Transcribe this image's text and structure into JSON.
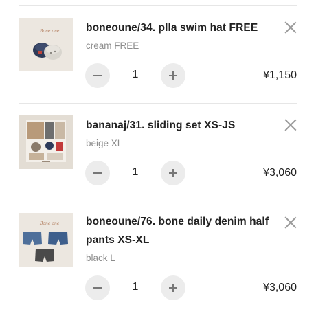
{
  "cart": {
    "items": [
      {
        "title": "boneoune/34. plla swim hat FREE",
        "variant": "cream FREE",
        "quantity": "1",
        "price": "¥1,150",
        "thumb_text": "Bone one"
      },
      {
        "title": "bananaj/31. sliding set XS-JS",
        "variant": "beige XL",
        "quantity": "1",
        "price": "¥3,060"
      },
      {
        "title_line1": "boneoune/76. bone daily denim half",
        "title_line2": "pants XS-XL",
        "variant": "black L",
        "quantity": "1",
        "price": "¥3,060",
        "thumb_text": "Bone one"
      }
    ]
  },
  "icons": {
    "remove": "close-icon",
    "decrease": "minus-icon",
    "increase": "plus-icon"
  },
  "colors": {
    "button_bg": "#ececec",
    "divider": "#e6e6e6",
    "variant_text": "#8c8c8c"
  }
}
